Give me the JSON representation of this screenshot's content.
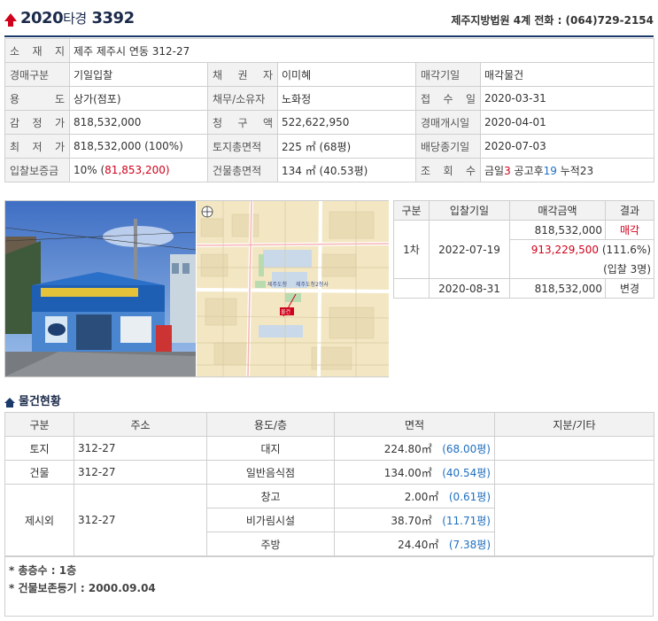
{
  "header": {
    "case_year": "2020",
    "case_kind": "타경",
    "case_no": "3392",
    "court_info": "제주지방법원 4계 전화 : (064)729-2154"
  },
  "info": {
    "r1": {
      "label": "소 재 지",
      "value": "제주 제주시 연동 312-27"
    },
    "r2": {
      "l1": "경매구분",
      "v1": "기일입찰",
      "l2": "채 권 자",
      "v2": "이미혜",
      "l3": "매각기일",
      "v3": "매각물건"
    },
    "r3": {
      "l1": "용 도",
      "v1": "상가(점포)",
      "l2": "채무/소유자",
      "v2": "노화정",
      "l3": "접 수 일",
      "v3": "2020-03-31"
    },
    "r4": {
      "l1": "감 정 가",
      "v1": "818,532,000",
      "l2": "청 구 액",
      "v2": "522,622,950",
      "l3": "경매개시일",
      "v3": "2020-04-01"
    },
    "r5": {
      "l1": "최 저 가",
      "v1": "818,532,000 (100%)",
      "l2": "토지총면적",
      "v2": "225 ㎡ (68평)",
      "l3": "배당종기일",
      "v3": "2020-07-03"
    },
    "r6": {
      "l1": "입찰보증금",
      "v1a": "10% (",
      "v1b": "81,853,200",
      "v1c": ")",
      "l2": "건물총면적",
      "v2": "134 ㎡ (40.53평)",
      "l3": "조 회 수",
      "v3a": "금일",
      "v3b": "3",
      "v3c": " 공고후",
      "v3d": "19",
      "v3e": " 누적23"
    }
  },
  "photos": {
    "map_label1": "제주도청",
    "map_label2": "제주도청2청사",
    "map_pin": "물건"
  },
  "bid": {
    "headers": [
      "구분",
      "입찰기일",
      "매각금액",
      "결과"
    ],
    "rows": {
      "round": "1차",
      "date1": "2022-07-19",
      "amount1": "818,532,000",
      "result1": "매각",
      "sold_amount": "913,229,500",
      "sold_pct": " (111.6%)",
      "bidders": "(입찰 3명)",
      "date2": "2020-08-31",
      "amount2": "818,532,000",
      "result2": "변경"
    }
  },
  "section_title": "물건현황",
  "property": {
    "headers": [
      "구분",
      "주소",
      "용도/층",
      "면적",
      "지분/기타"
    ],
    "rows": [
      {
        "kind": "토지",
        "addr": "312-27",
        "use": "대지",
        "area": "224.80㎡",
        "pyeong": "(68.00평)"
      },
      {
        "kind": "건물",
        "addr": "312-27",
        "use": "일반음식점",
        "area": "134.00㎡",
        "pyeong": "(40.54평)"
      },
      {
        "kind": "제시외",
        "addr": "312-27",
        "use": "창고",
        "area": "2.00㎡",
        "pyeong": "(0.61평)"
      },
      {
        "use": "비가림시설",
        "area": "38.70㎡",
        "pyeong": "(11.71평)"
      },
      {
        "use": "주방",
        "area": "24.40㎡",
        "pyeong": "(7.38평)"
      }
    ]
  },
  "notes": {
    "n1": "* 총층수 : 1층",
    "n2": "* 건물보존등기 : 2000.09.04"
  }
}
